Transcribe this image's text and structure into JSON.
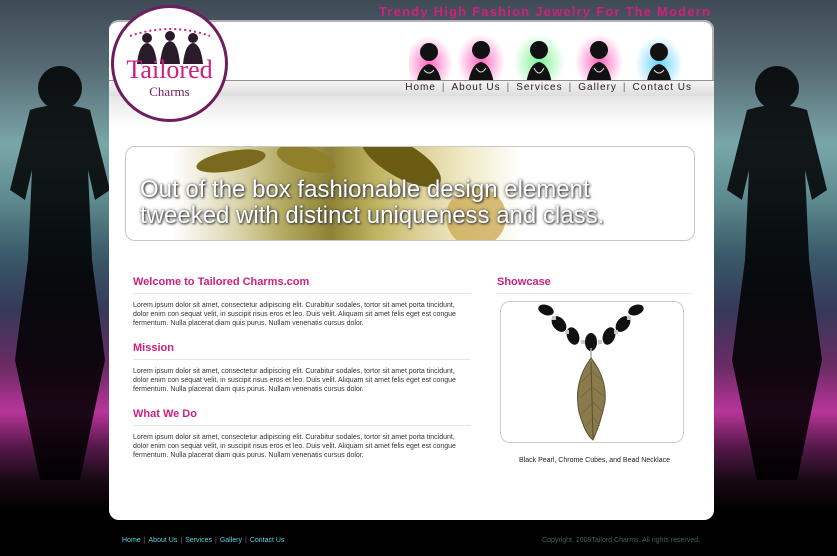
{
  "header": {
    "tagline": "Trendy High Fashion Jewelry For The Modern Day Woman!",
    "logo_line1": "Tailored",
    "logo_line2": "Charms"
  },
  "nav": {
    "items": [
      {
        "label": "Home"
      },
      {
        "label": "About Us"
      },
      {
        "label": "Services"
      },
      {
        "label": "Gallery"
      },
      {
        "label": "Contact Us"
      }
    ],
    "separator": "|"
  },
  "banner": {
    "line1": "Out of the box fashionable design element",
    "line2": "tweeked with distinct uniqueness and class."
  },
  "main": {
    "sections": [
      {
        "heading": "Welcome to Tailored Charms.com",
        "body": "Lorem ipsum dolor sit amet, consectetur adipiscing elit. Curabitur sodales, tortor sit amet porta tincidunt, dolor enim con sequat velit, in suscipit risus eros et leo. Duis velit. Aliquam sit amet felis eget est congue fermentum. Nulla placerat diam quis purus. Nullam venenatis cursus dolor."
      },
      {
        "heading": "Mission",
        "body": "Lorem ipsum dolor sit amet, consectetur adipiscing elit. Curabitur sodales, tortor sit amet porta tincidunt, dolor enim con sequat velit, in suscipit risus eros et leo. Duis velit. Aliquam sit amet felis eget est congue fermentum. Nulla placerat diam quis purus. Nullam venenatis cursus dolor."
      },
      {
        "heading": "What We Do",
        "body": "Lorem ipsum dolor sit amet, consectetur adipiscing elit. Curabitur sodales, tortor sit amet porta tincidunt, dolor enim con sequat velit, in suscipit risus eros et leo. Duis velit. Aliquam sit amet felis eget est congue fermentum. Nulla placerat diam quis purus. Nullam venenatis cursus dolor."
      }
    ]
  },
  "showcase": {
    "heading": "Showcase",
    "caption": "Black Pearl, Chrome Cubes, and Bead Necklace"
  },
  "footer": {
    "links": [
      {
        "label": "Home"
      },
      {
        "label": "About Us"
      },
      {
        "label": "Services"
      },
      {
        "label": "Gallery"
      },
      {
        "label": "Contact Us"
      }
    ],
    "separator": "|",
    "copyright": "Copyright, 2009Tailord Charms. All rights reserved."
  },
  "colors": {
    "accent_pink": "#d0207f",
    "accent_purple": "#6e1e5f",
    "footer_link": "#5fd3e0"
  }
}
